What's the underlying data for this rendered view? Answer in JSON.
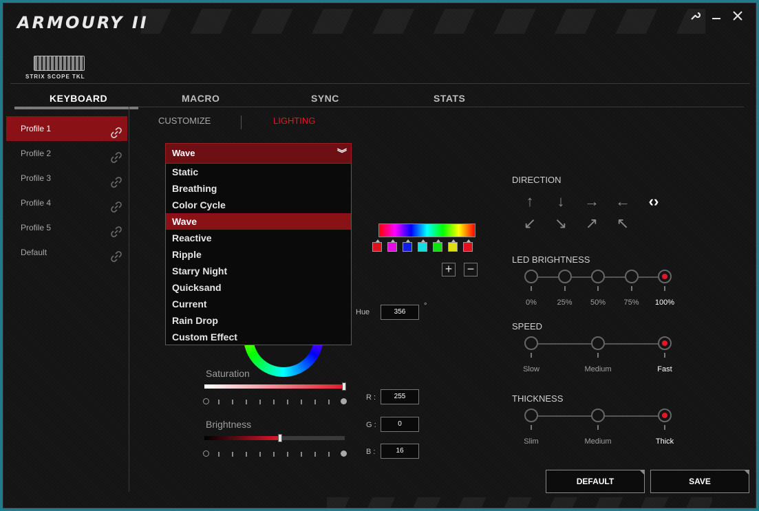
{
  "window": {
    "app_title": "ARMOURY II",
    "device_name": "STRIX SCOPE TKL",
    "icons": {
      "settings": "wrench-icon",
      "minimize": "minimize-icon",
      "close": "close-icon"
    }
  },
  "main_tabs": [
    {
      "label": "KEYBOARD",
      "active": true
    },
    {
      "label": "MACRO",
      "active": false
    },
    {
      "label": "SYNC",
      "active": false
    },
    {
      "label": "STATS",
      "active": false
    }
  ],
  "sub_tabs": [
    {
      "label": "CUSTOMIZE",
      "active": false
    },
    {
      "label": "LIGHTING",
      "active": true
    }
  ],
  "profiles": [
    {
      "label": "Profile 1",
      "active": true
    },
    {
      "label": "Profile 2",
      "active": false
    },
    {
      "label": "Profile 3",
      "active": false
    },
    {
      "label": "Profile 4",
      "active": false
    },
    {
      "label": "Profile 5",
      "active": false
    },
    {
      "label": "Default",
      "active": false
    }
  ],
  "effect": {
    "selected": "Wave",
    "options": [
      "Static",
      "Breathing",
      "Color Cycle",
      "Wave",
      "Reactive",
      "Ripple",
      "Starry Night",
      "Quicksand",
      "Current",
      "Rain Drop",
      "Custom Effect"
    ]
  },
  "color": {
    "hue_label": "Hue",
    "hue_value": "356",
    "hue_unit": "°",
    "saturation_label": "Saturation",
    "saturation_level": 1.0,
    "brightness_label": "Brightness",
    "brightness_level": 0.54,
    "r_label": "R :",
    "r_value": "255",
    "g_label": "G :",
    "g_value": "0",
    "b_label": "B :",
    "b_value": "16",
    "add_label": "+",
    "remove_label": "−",
    "wave_swatches": [
      "#e0101e",
      "#e010e0",
      "#1020e0",
      "#10e0e0",
      "#10e010",
      "#e0e010",
      "#e0101e"
    ]
  },
  "direction": {
    "title": "DIRECTION",
    "arrows": [
      {
        "glyph": "↑",
        "icon": "arrow-up-icon",
        "active": false
      },
      {
        "glyph": "↓",
        "icon": "arrow-down-icon",
        "active": false
      },
      {
        "glyph": "→",
        "icon": "arrow-right-icon",
        "active": false
      },
      {
        "glyph": "←",
        "icon": "arrow-left-icon",
        "active": false
      },
      {
        "glyph": "‹›",
        "icon": "arrow-horizontal-icon",
        "active": true
      },
      {
        "glyph": "↙",
        "icon": "arrow-down-left-icon",
        "active": false
      },
      {
        "glyph": "↘",
        "icon": "arrow-down-right-icon",
        "active": false
      },
      {
        "glyph": "↗",
        "icon": "arrow-up-right-icon",
        "active": false
      },
      {
        "glyph": "↖",
        "icon": "arrow-up-left-icon",
        "active": false
      }
    ]
  },
  "led_brightness": {
    "title": "LED BRIGHTNESS",
    "levels": [
      "0%",
      "25%",
      "50%",
      "75%",
      "100%"
    ],
    "selected_index": 4
  },
  "speed": {
    "title": "SPEED",
    "levels": [
      "Slow",
      "Medium",
      "Fast"
    ],
    "selected_index": 2
  },
  "thickness": {
    "title": "THICKNESS",
    "levels": [
      "Slim",
      "Medium",
      "Thick"
    ],
    "selected_index": 2
  },
  "footer": {
    "default_label": "DEFAULT",
    "save_label": "SAVE"
  },
  "colors": {
    "accent": "#8a1217",
    "accent_bright": "#e0182a",
    "background": "#141414"
  }
}
